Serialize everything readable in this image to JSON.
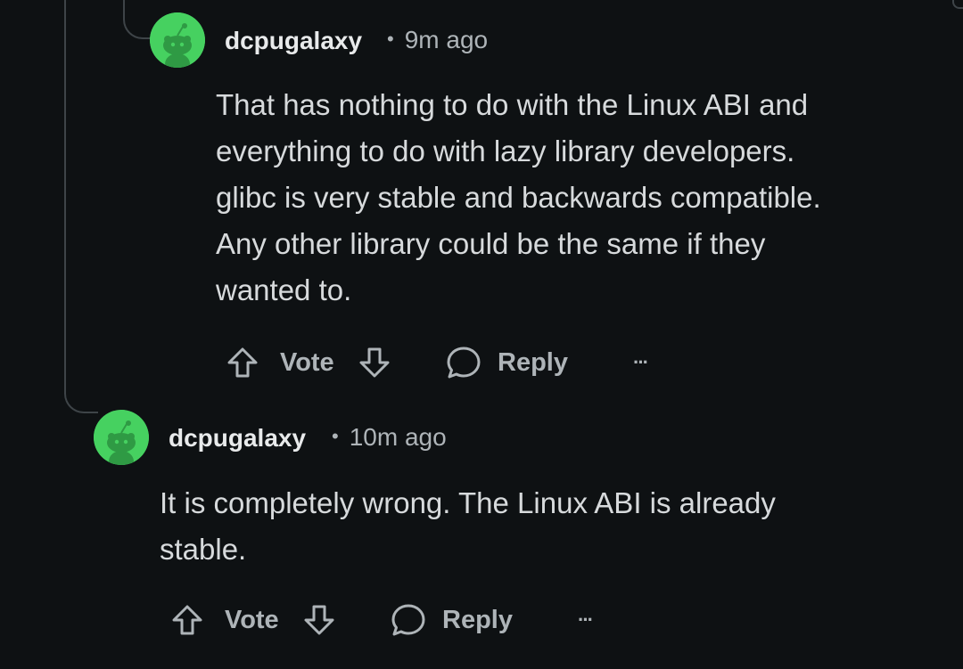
{
  "comments": [
    {
      "author": "dcpugalaxy",
      "separator": "•",
      "time": "9m ago",
      "body": "That has nothing to do with the Linux ABI and\neverything to do with lazy library developers.\nglibc is very stable and backwards compatible.\nAny other library could be the same if they\nwanted to.",
      "vote_label": "Vote",
      "reply_label": "Reply",
      "more_label": "···"
    },
    {
      "author": "dcpugalaxy",
      "separator": "•",
      "time": "10m ago",
      "body": "It is completely wrong. The Linux ABI is already\nstable.",
      "vote_label": "Vote",
      "reply_label": "Reply",
      "more_label": "···"
    }
  ],
  "colors": {
    "background": "#0e1113",
    "avatar_green": "#46d160",
    "text": "#d7dadc",
    "muted": "#aeb4b8",
    "thread_line": "#3e4448"
  }
}
